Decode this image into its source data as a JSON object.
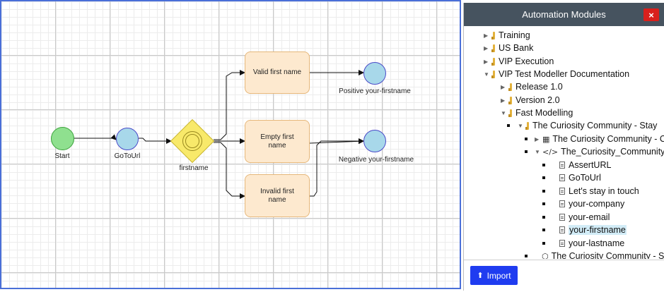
{
  "canvas": {
    "nodes": {
      "start": "Start",
      "gotourl": "GoToUrl",
      "gateway": "firstname",
      "task_valid": "Valid first name",
      "task_empty": "Empty first name",
      "task_invalid": "Invalid first name",
      "end_positive": "Positive your-firstname",
      "end_negative": "Negative your-firstname"
    }
  },
  "panel": {
    "title": "Automation Modules",
    "close_label": "×",
    "import_label": "Import",
    "tree": [
      {
        "label": "Training"
      },
      {
        "label": "US Bank"
      },
      {
        "label": "VIP Execution"
      },
      {
        "label": "VIP Test Modeller Documentation"
      },
      {
        "label": "Release 1.0"
      },
      {
        "label": "Version 2.0"
      },
      {
        "label": "Fast Modelling"
      },
      {
        "label": "The Curiosity Community - Stay"
      },
      {
        "label": "The Curiosity Community - C"
      },
      {
        "label": "The_Curiosity_Community_C"
      },
      {
        "label": "AssertURL"
      },
      {
        "label": "GoToUrl"
      },
      {
        "label": "Let's stay in touch"
      },
      {
        "label": "your-company"
      },
      {
        "label": "your-email"
      },
      {
        "label": "your-firstname"
      },
      {
        "label": "your-lastname"
      },
      {
        "label": "The Curiosity Community - S"
      }
    ]
  },
  "colors": {
    "header_bg": "#46535f",
    "close_bg": "#d9201c",
    "import_bg": "#1f3cf0",
    "canvas_border": "#4a6fd8",
    "start_fill": "#8fe08f",
    "activity_fill": "#a8d8ea",
    "gateway_fill": "#f8e96a",
    "task_fill": "#fde9cf",
    "selection_highlight": "#d2ecf7"
  }
}
